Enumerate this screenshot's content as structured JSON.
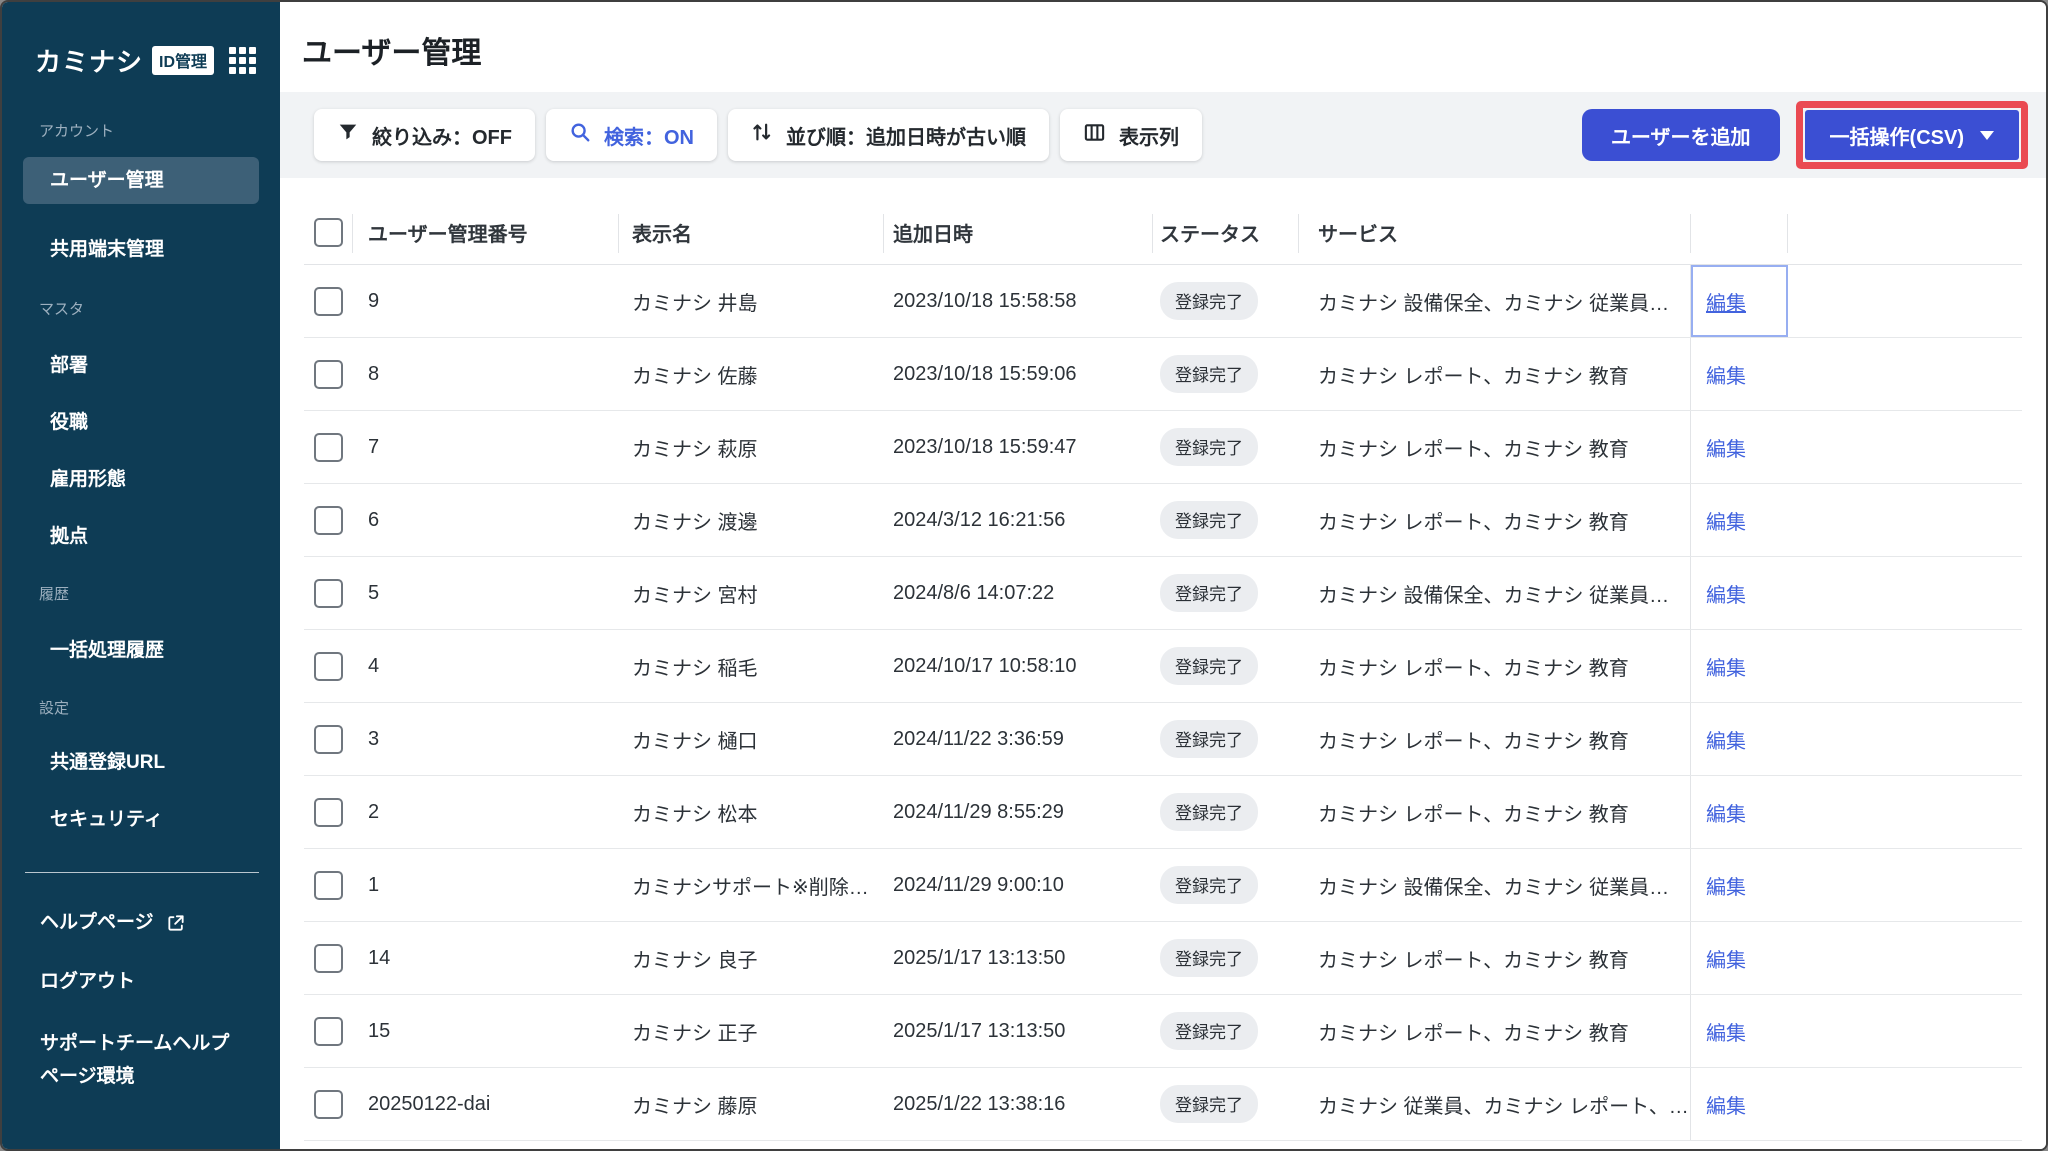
{
  "colors": {
    "sidebarBg": "#0e3c55",
    "sidebarSelected": "#3d6077",
    "sectionLabel": "#9db0bf",
    "accent": "#3b4fd3",
    "link": "#4263de",
    "highlight": "#ea4a52",
    "stripBg": "#f1f3f5",
    "border": "#e2e4e7",
    "badgeBg": "#ebedf0",
    "focusRing": "#97aef1"
  },
  "app": {
    "logo_text": "カミナシ",
    "logo_badge": "ID管理"
  },
  "sidebar": {
    "sections": [
      {
        "label": "アカウント",
        "items": [
          {
            "label": "ユーザー管理",
            "active": true
          },
          {
            "label": "共用端末管理",
            "active": false
          }
        ]
      },
      {
        "label": "マスタ",
        "items": [
          {
            "label": "部署",
            "active": false
          },
          {
            "label": "役職",
            "active": false
          },
          {
            "label": "雇用形態",
            "active": false
          },
          {
            "label": "拠点",
            "active": false
          }
        ]
      },
      {
        "label": "履歴",
        "items": [
          {
            "label": "一括処理履歴",
            "active": false
          }
        ]
      },
      {
        "label": "設定",
        "items": [
          {
            "label": "共通登録URL",
            "active": false
          },
          {
            "label": "セキュリティ",
            "active": false
          }
        ]
      }
    ],
    "footer_items": [
      {
        "label": "ヘルプページ",
        "external": true
      },
      {
        "label": "ログアウト",
        "external": false
      },
      {
        "label": "サポートチームヘルプページ環境",
        "external": false
      }
    ]
  },
  "header": {
    "title": "ユーザー管理"
  },
  "toolbar": {
    "filter_label": "絞り込み：OFF",
    "search_label": "検索：ON",
    "sort_label": "並び順：追加日時が古い順",
    "columns_label": "表示列",
    "add_user_label": "ユーザーを追加",
    "bulk_label": "一括操作(CSV)"
  },
  "table": {
    "headers": {
      "id": "ユーザー管理番号",
      "name": "表示名",
      "added": "追加日時",
      "status": "ステータス",
      "services": "サービス"
    },
    "edit_label": "編集",
    "rows": [
      {
        "id": "9",
        "name": "カミナシ 井島",
        "added": "2023/10/18 15:58:58",
        "status": "登録完了",
        "services": "カミナシ 設備保全、カミナシ 従業員…",
        "focused": true
      },
      {
        "id": "8",
        "name": "カミナシ 佐藤",
        "added": "2023/10/18 15:59:06",
        "status": "登録完了",
        "services": "カミナシ レポート、カミナシ 教育",
        "focused": false
      },
      {
        "id": "7",
        "name": "カミナシ 萩原",
        "added": "2023/10/18 15:59:47",
        "status": "登録完了",
        "services": "カミナシ レポート、カミナシ 教育",
        "focused": false
      },
      {
        "id": "6",
        "name": "カミナシ 渡邊",
        "added": "2024/3/12 16:21:56",
        "status": "登録完了",
        "services": "カミナシ レポート、カミナシ 教育",
        "focused": false
      },
      {
        "id": "5",
        "name": "カミナシ 宮村",
        "added": "2024/8/6 14:07:22",
        "status": "登録完了",
        "services": "カミナシ 設備保全、カミナシ 従業員…",
        "focused": false
      },
      {
        "id": "4",
        "name": "カミナシ 稲毛",
        "added": "2024/10/17 10:58:10",
        "status": "登録完了",
        "services": "カミナシ レポート、カミナシ 教育",
        "focused": false
      },
      {
        "id": "3",
        "name": "カミナシ 樋口",
        "added": "2024/11/22 3:36:59",
        "status": "登録完了",
        "services": "カミナシ レポート、カミナシ 教育",
        "focused": false
      },
      {
        "id": "2",
        "name": "カミナシ 松本",
        "added": "2024/11/29 8:55:29",
        "status": "登録完了",
        "services": "カミナシ レポート、カミナシ 教育",
        "focused": false
      },
      {
        "id": "1",
        "name": "カミナシサポート※削除…",
        "added": "2024/11/29 9:00:10",
        "status": "登録完了",
        "services": "カミナシ 設備保全、カミナシ 従業員…",
        "focused": false
      },
      {
        "id": "14",
        "name": "カミナシ 良子",
        "added": "2025/1/17 13:13:50",
        "status": "登録完了",
        "services": "カミナシ レポート、カミナシ 教育",
        "focused": false
      },
      {
        "id": "15",
        "name": "カミナシ 正子",
        "added": "2025/1/17 13:13:50",
        "status": "登録完了",
        "services": "カミナシ レポート、カミナシ 教育",
        "focused": false
      },
      {
        "id": "20250122-dai",
        "name": "カミナシ 藤原",
        "added": "2025/1/22 13:38:16",
        "status": "登録完了",
        "services": "カミナシ 従業員、カミナシ レポート、…",
        "focused": false
      }
    ]
  }
}
